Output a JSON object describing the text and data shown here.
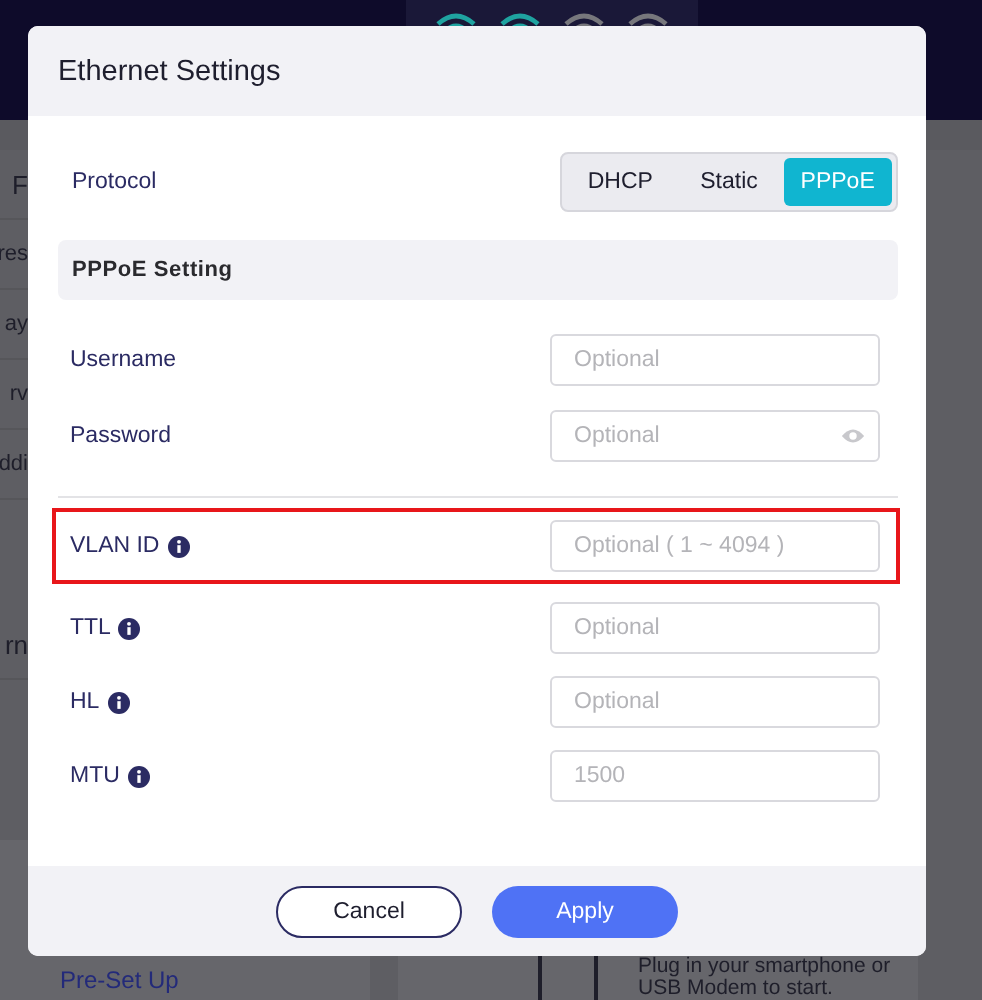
{
  "background": {
    "network_icons": [
      {
        "active": true
      },
      {
        "active": true
      },
      {
        "active": false
      },
      {
        "active": false
      }
    ],
    "fragments": [
      "F",
      "res",
      "ay",
      "rv",
      "ddi",
      "rn"
    ],
    "cards": [
      {
        "link": "Pre-Set Up"
      },
      {
        "text": "Plug in your smartphone or USB Modem to start."
      }
    ]
  },
  "dialog": {
    "title": "Ethernet Settings",
    "protocol": {
      "label": "Protocol",
      "options": [
        {
          "label": "DHCP",
          "selected": false
        },
        {
          "label": "Static",
          "selected": false
        },
        {
          "label": "PPPoE",
          "selected": true
        }
      ]
    },
    "section": "PPPoE Setting",
    "groups": [
      [
        {
          "label": "Username",
          "info": false,
          "placeholder": "Optional",
          "reveal": false,
          "highlighted": false
        },
        {
          "label": "Password",
          "info": false,
          "placeholder": "Optional",
          "reveal": true,
          "highlighted": false
        }
      ],
      [
        {
          "label": "VLAN ID",
          "info": true,
          "placeholder": "Optional ( 1 ~ 4094 )",
          "reveal": false,
          "highlighted": true
        },
        {
          "label": "TTL",
          "info": true,
          "placeholder": "Optional",
          "reveal": false,
          "highlighted": false
        },
        {
          "label": "HL",
          "info": true,
          "placeholder": "Optional",
          "reveal": false,
          "highlighted": false
        },
        {
          "label": "MTU",
          "info": true,
          "placeholder": "1500",
          "reveal": false,
          "highlighted": false
        }
      ]
    ],
    "buttons": [
      {
        "label": "Cancel",
        "primary": false
      },
      {
        "label": "Apply",
        "primary": true
      }
    ]
  }
}
